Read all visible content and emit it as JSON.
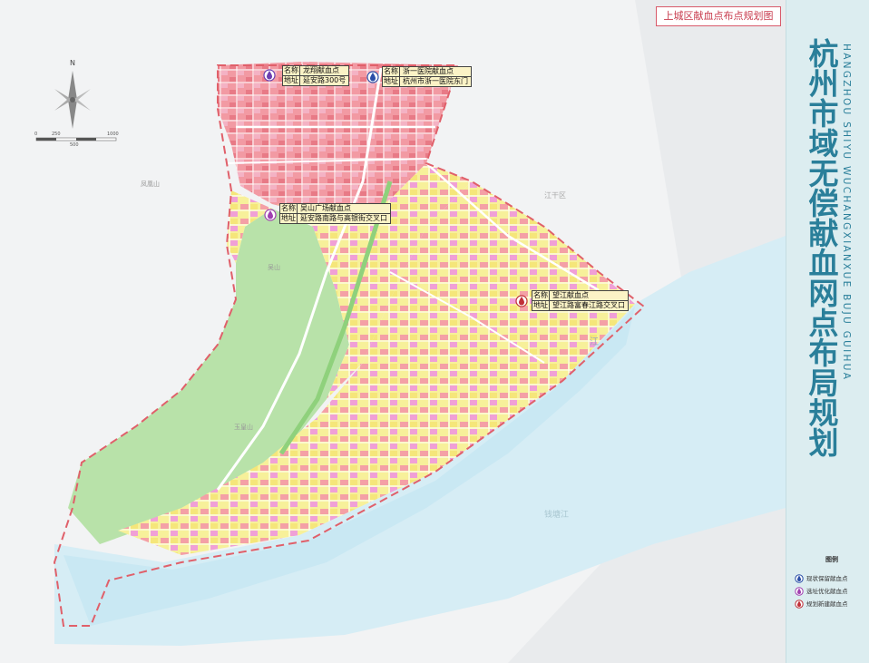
{
  "map": {
    "title_cn": "杭州市域无偿献血网点布局规划",
    "title_en": "HANGZHOU SHIYU WUCHANGXIANXUE BUJU GUIHUA",
    "subtitle": "上城区献血点布点规划图",
    "north_label": "N",
    "scale_labels": [
      "0",
      "250",
      "500",
      "1000"
    ],
    "place_labels": [
      "凤凰山",
      "玉皇山",
      "钱塘江",
      "江干区",
      "吴山",
      "钱",
      "江"
    ]
  },
  "callouts": [
    {
      "type": "existing",
      "name_key": "名称",
      "name": "龙翔献血点",
      "addr_key": "地址",
      "addr": "延安路300号",
      "color": "#6b3fb0"
    },
    {
      "type": "existing",
      "name_key": "名称",
      "name": "浙一医院献血点",
      "addr_key": "地址",
      "addr": "杭州市浙一医院东门",
      "color": "#2b4fa8"
    },
    {
      "type": "optimize",
      "name_key": "名称",
      "name": "吴山广场献血点",
      "addr_key": "地址",
      "addr": "延安路南路与高银街交叉口",
      "color": "#a040b0"
    },
    {
      "type": "new",
      "name_key": "名称",
      "name": "望江献血点",
      "addr_key": "地址",
      "addr": "望江路富春江路交叉口",
      "color": "#c03038"
    }
  ],
  "legend": {
    "title": "图例",
    "items": [
      {
        "label": "现状保留献血点",
        "color": "#2b4fa8"
      },
      {
        "label": "选址优化献血点",
        "color": "#a040b0"
      },
      {
        "label": "规划新建献血点",
        "color": "#c03038"
      }
    ]
  },
  "colors": {
    "river": "#cfeaf3",
    "residential": "#f7f09a",
    "commercial": "#f4a0a6",
    "public": "#f0a0d6",
    "green": "#b5e0a6",
    "boundary": "#e0606a",
    "accent": "#2a7f9a"
  }
}
